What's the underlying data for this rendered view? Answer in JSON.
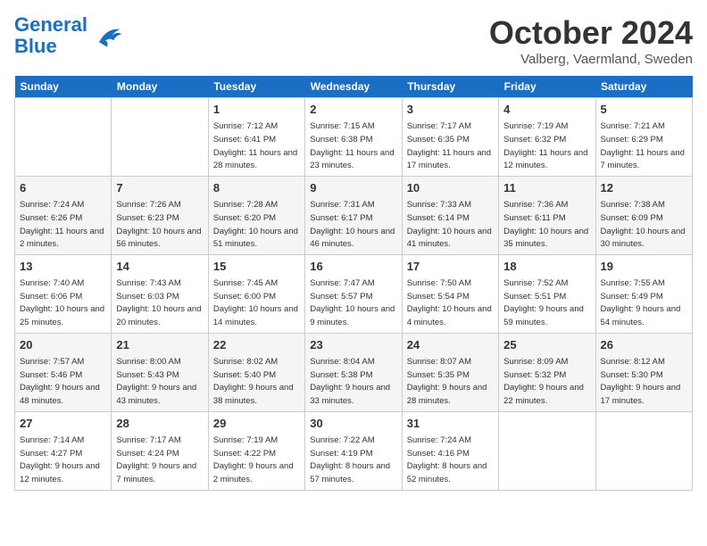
{
  "header": {
    "logo_line1": "General",
    "logo_line2": "Blue",
    "month": "October 2024",
    "location": "Valberg, Vaermland, Sweden"
  },
  "weekdays": [
    "Sunday",
    "Monday",
    "Tuesday",
    "Wednesday",
    "Thursday",
    "Friday",
    "Saturday"
  ],
  "weeks": [
    [
      {
        "day": "",
        "info": ""
      },
      {
        "day": "",
        "info": ""
      },
      {
        "day": "1",
        "info": "Sunrise: 7:12 AM\nSunset: 6:41 PM\nDaylight: 11 hours and 28 minutes."
      },
      {
        "day": "2",
        "info": "Sunrise: 7:15 AM\nSunset: 6:38 PM\nDaylight: 11 hours and 23 minutes."
      },
      {
        "day": "3",
        "info": "Sunrise: 7:17 AM\nSunset: 6:35 PM\nDaylight: 11 hours and 17 minutes."
      },
      {
        "day": "4",
        "info": "Sunrise: 7:19 AM\nSunset: 6:32 PM\nDaylight: 11 hours and 12 minutes."
      },
      {
        "day": "5",
        "info": "Sunrise: 7:21 AM\nSunset: 6:29 PM\nDaylight: 11 hours and 7 minutes."
      }
    ],
    [
      {
        "day": "6",
        "info": "Sunrise: 7:24 AM\nSunset: 6:26 PM\nDaylight: 11 hours and 2 minutes."
      },
      {
        "day": "7",
        "info": "Sunrise: 7:26 AM\nSunset: 6:23 PM\nDaylight: 10 hours and 56 minutes."
      },
      {
        "day": "8",
        "info": "Sunrise: 7:28 AM\nSunset: 6:20 PM\nDaylight: 10 hours and 51 minutes."
      },
      {
        "day": "9",
        "info": "Sunrise: 7:31 AM\nSunset: 6:17 PM\nDaylight: 10 hours and 46 minutes."
      },
      {
        "day": "10",
        "info": "Sunrise: 7:33 AM\nSunset: 6:14 PM\nDaylight: 10 hours and 41 minutes."
      },
      {
        "day": "11",
        "info": "Sunrise: 7:36 AM\nSunset: 6:11 PM\nDaylight: 10 hours and 35 minutes."
      },
      {
        "day": "12",
        "info": "Sunrise: 7:38 AM\nSunset: 6:09 PM\nDaylight: 10 hours and 30 minutes."
      }
    ],
    [
      {
        "day": "13",
        "info": "Sunrise: 7:40 AM\nSunset: 6:06 PM\nDaylight: 10 hours and 25 minutes."
      },
      {
        "day": "14",
        "info": "Sunrise: 7:43 AM\nSunset: 6:03 PM\nDaylight: 10 hours and 20 minutes."
      },
      {
        "day": "15",
        "info": "Sunrise: 7:45 AM\nSunset: 6:00 PM\nDaylight: 10 hours and 14 minutes."
      },
      {
        "day": "16",
        "info": "Sunrise: 7:47 AM\nSunset: 5:57 PM\nDaylight: 10 hours and 9 minutes."
      },
      {
        "day": "17",
        "info": "Sunrise: 7:50 AM\nSunset: 5:54 PM\nDaylight: 10 hours and 4 minutes."
      },
      {
        "day": "18",
        "info": "Sunrise: 7:52 AM\nSunset: 5:51 PM\nDaylight: 9 hours and 59 minutes."
      },
      {
        "day": "19",
        "info": "Sunrise: 7:55 AM\nSunset: 5:49 PM\nDaylight: 9 hours and 54 minutes."
      }
    ],
    [
      {
        "day": "20",
        "info": "Sunrise: 7:57 AM\nSunset: 5:46 PM\nDaylight: 9 hours and 48 minutes."
      },
      {
        "day": "21",
        "info": "Sunrise: 8:00 AM\nSunset: 5:43 PM\nDaylight: 9 hours and 43 minutes."
      },
      {
        "day": "22",
        "info": "Sunrise: 8:02 AM\nSunset: 5:40 PM\nDaylight: 9 hours and 38 minutes."
      },
      {
        "day": "23",
        "info": "Sunrise: 8:04 AM\nSunset: 5:38 PM\nDaylight: 9 hours and 33 minutes."
      },
      {
        "day": "24",
        "info": "Sunrise: 8:07 AM\nSunset: 5:35 PM\nDaylight: 9 hours and 28 minutes."
      },
      {
        "day": "25",
        "info": "Sunrise: 8:09 AM\nSunset: 5:32 PM\nDaylight: 9 hours and 22 minutes."
      },
      {
        "day": "26",
        "info": "Sunrise: 8:12 AM\nSunset: 5:30 PM\nDaylight: 9 hours and 17 minutes."
      }
    ],
    [
      {
        "day": "27",
        "info": "Sunrise: 7:14 AM\nSunset: 4:27 PM\nDaylight: 9 hours and 12 minutes."
      },
      {
        "day": "28",
        "info": "Sunrise: 7:17 AM\nSunset: 4:24 PM\nDaylight: 9 hours and 7 minutes."
      },
      {
        "day": "29",
        "info": "Sunrise: 7:19 AM\nSunset: 4:22 PM\nDaylight: 9 hours and 2 minutes."
      },
      {
        "day": "30",
        "info": "Sunrise: 7:22 AM\nSunset: 4:19 PM\nDaylight: 8 hours and 57 minutes."
      },
      {
        "day": "31",
        "info": "Sunrise: 7:24 AM\nSunset: 4:16 PM\nDaylight: 8 hours and 52 minutes."
      },
      {
        "day": "",
        "info": ""
      },
      {
        "day": "",
        "info": ""
      }
    ]
  ]
}
